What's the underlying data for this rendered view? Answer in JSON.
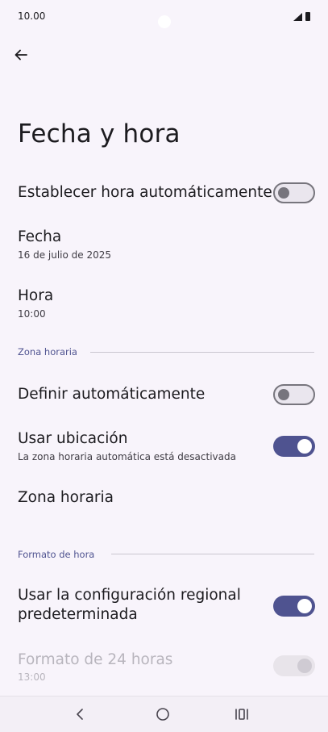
{
  "status_bar": {
    "time": "10.00"
  },
  "header": {
    "title": "Fecha y hora"
  },
  "settings": {
    "auto_time": {
      "label": "Establecer hora automáticamente",
      "enabled": false
    },
    "date": {
      "label": "Fecha",
      "value": "16 de julio de 2025"
    },
    "time": {
      "label": "Hora",
      "value": "10:00"
    },
    "time_zone_section": {
      "header": "Zona horaria"
    },
    "auto_zone": {
      "label": "Definir automáticamente",
      "enabled": false
    },
    "use_location": {
      "label": "Usar ubicación",
      "subtitle": "La zona horaria automática está desactivada",
      "enabled": true
    },
    "time_zone": {
      "label": "Zona horaria"
    },
    "time_format_section": {
      "header": "Formato de hora"
    },
    "regional_default": {
      "label_line1": "Usar la configuración regional",
      "label_line2": "predeterminada",
      "enabled": true
    },
    "format_24h": {
      "label": "Formato de 24 horas",
      "value": "13:00",
      "enabled": true,
      "disabled": true
    }
  },
  "colors": {
    "accent": "#4f5390",
    "background": "#f8f4fb",
    "switch_off": "#77757d"
  },
  "icons": {
    "back": "arrow-left-icon",
    "nav_back": "chevron-left-icon",
    "nav_home": "circle-home-icon",
    "nav_recents": "recents-icon"
  }
}
